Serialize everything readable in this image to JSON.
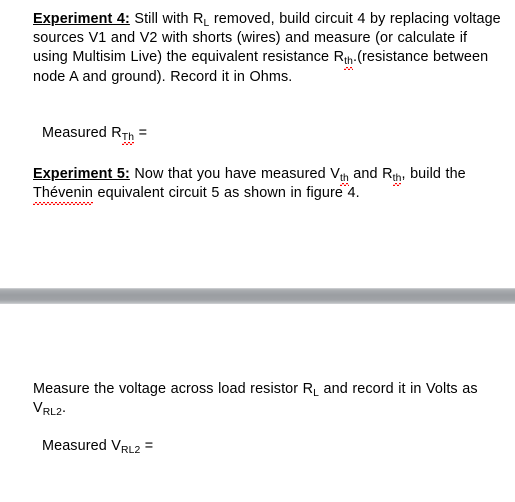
{
  "document": {
    "sections": [
      {
        "id": "experiment-4",
        "label": "Experiment 4:",
        "body_pre": "  Still with R",
        "sub_1": "L",
        "body_mid": " removed, build circuit 4 by replacing voltage sources V1 and V2 with shorts (wires) and measure (or calculate if using Multisim Live) the equivalent resistance R",
        "sub_2": "th",
        "body_post": ".(resistance between node A and ground). Record it in Ohms."
      },
      {
        "id": "measured-rth",
        "text_pre": "Measured R",
        "sub": "Th",
        "text_post": " ="
      },
      {
        "id": "experiment-5",
        "label": "Experiment 5:",
        "body_pre": "  Now that you have measured V",
        "sub_1": "th",
        "body_mid": " and R",
        "sub_2": "th",
        "body_mid2": ", build the ",
        "spellword": "Thévenin",
        "body_post": " equivalent circuit 5 as shown in figure 4."
      },
      {
        "id": "measure-vrl2-instruction",
        "text_pre": "Measure the voltage across load resistor R",
        "sub_1": "L",
        "text_mid": " and record it in Volts as V",
        "sub_2": "RL2",
        "text_post": "."
      },
      {
        "id": "measured-vrl2",
        "text_pre": "Measured V",
        "sub": "RL2",
        "text_post": " ="
      }
    ]
  },
  "divider": {
    "name": "page-break-gap",
    "color_top": "#b4b7ba",
    "color_mid": "#9a9da1",
    "color_bottom": "#d5d7d9"
  },
  "colors": {
    "page_background": "#ffffff",
    "text": "#000000",
    "spellcheck_underline": "#ff0000"
  }
}
